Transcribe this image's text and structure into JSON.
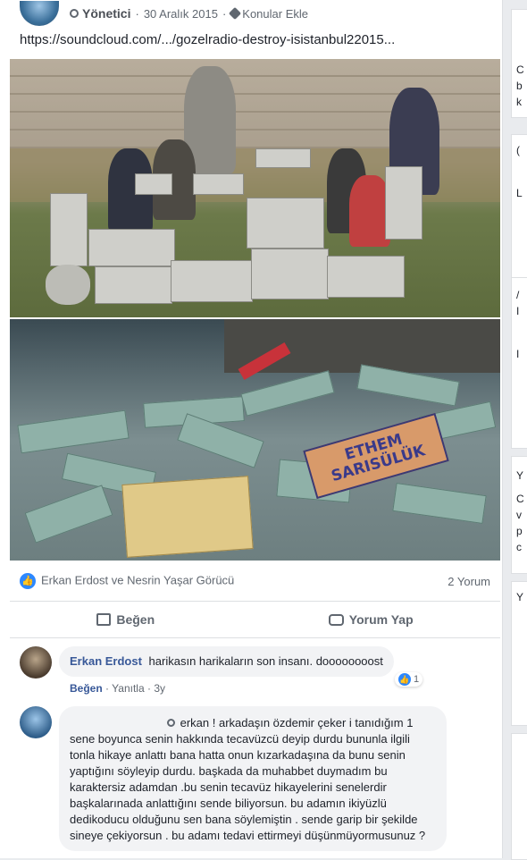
{
  "post": {
    "role": "Yönetici",
    "date": "30 Aralık 2015",
    "separator": "·",
    "topics": "Konular Ekle",
    "link": "https://soundcloud.com/.../gozelradio-destroy-isistanbul22015...",
    "sign_line1": "ETHEM",
    "sign_line2": "SARISÜLÜK"
  },
  "reactions": {
    "names": "Erkan Erdost ve Nesrin Yaşar Görücü",
    "comment_count": "2 Yorum",
    "like_icon": "thumbs-up-icon"
  },
  "actions": {
    "like_label": "Beğen",
    "comment_label": "Yorum Yap"
  },
  "comments": [
    {
      "author": "Erkan Erdost",
      "text": "harikasın harikaların son insanı. doooooooost",
      "like_label": "Beğen",
      "reply_label": "Yanıtla",
      "age": "3y",
      "reaction_count": "1"
    },
    {
      "author": "",
      "text": "erkan ! arkadaşın özdemir çeker i tanıdığım 1 sene boyunca senin hakkında tecavüzcü deyip durdu bununla ilgili tonla hikaye anlattı bana hatta onun kızarkadaşına da bunu senin yaptığını söyleyip durdu. başkada da muhabbet duymadım bu karaktersiz adamdan .bu senin tecavüz hikayelerini senelerdir başkalarınada anlattığını sende biliyorsun. bu adamın ikiyüzlü dedikoducu olduğunu sen bana söylemiştin . sende garip bir şekilde sineye çekiyorsun . bu adamı tedavi ettirmeyi düşünmüyormusunuz ?"
    }
  ],
  "right_column": {
    "letters": [
      "C",
      "b",
      "k",
      "(",
      "L",
      "/",
      "I",
      "I",
      "Y",
      "C",
      "v",
      "p",
      "c",
      "Y"
    ]
  }
}
